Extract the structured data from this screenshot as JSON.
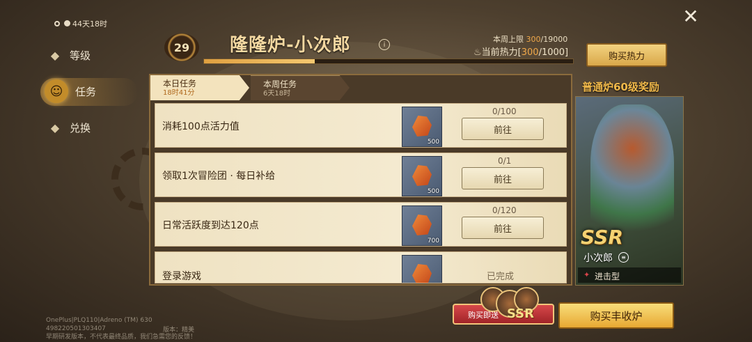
{
  "event_timer": "44天18时",
  "sidebar": {
    "items": [
      {
        "label": "等级",
        "icon": "level-icon"
      },
      {
        "label": "任务",
        "icon": "task-icon",
        "active": true
      },
      {
        "label": "兑换",
        "icon": "exchange-icon"
      }
    ]
  },
  "header": {
    "level": "29",
    "title": "隆隆炉-小次郎",
    "weekly_cap_label": "本周上限",
    "weekly_cap_value": "300",
    "weekly_cap_max": "/19000",
    "heat_label": "当前热力",
    "heat_value": "300",
    "heat_max": "/1000",
    "heat_progress_fraction": 0.3,
    "buy_heat_label": "购买热力"
  },
  "tabs": [
    {
      "label": "本日任务",
      "sub": "18时41分",
      "active": true
    },
    {
      "label": "本周任务",
      "sub": "6天18时",
      "active": false
    }
  ],
  "tasks": [
    {
      "label": "消耗100点活力值",
      "reward_qty": "500",
      "progress": "0/100",
      "action": "前往",
      "done": false
    },
    {
      "label": "领取1次冒险团 · 每日补给",
      "reward_qty": "500",
      "progress": "0/1",
      "action": "前往",
      "done": false
    },
    {
      "label": "日常活跃度到达120点",
      "reward_qty": "700",
      "progress": "0/120",
      "action": "前往",
      "done": false
    },
    {
      "label": "登录游戏",
      "reward_qty": "",
      "progress": "",
      "action": "已完成",
      "done": true
    }
  ],
  "reward_panel": {
    "title": "普通炉60级奖励",
    "rarity": "SSR",
    "name": "小次郎",
    "type": "进击型"
  },
  "bottom": {
    "gift_text": "购买即送",
    "gift_rarity": "SSR",
    "buy_furnace_label": "购买丰收炉"
  },
  "watermark": {
    "line1": "OnePlus|PLQ110|Adreno (TM) 630",
    "line2": "4982205013034​07",
    "line3": "早期研发版本，不代表最终品质，我们急需您的反馈！",
    "right": "版本：精美"
  },
  "colors": {
    "accent": "#f0a84a",
    "button_gold": "#e8a833",
    "panel_bg": "#f4ead0"
  }
}
